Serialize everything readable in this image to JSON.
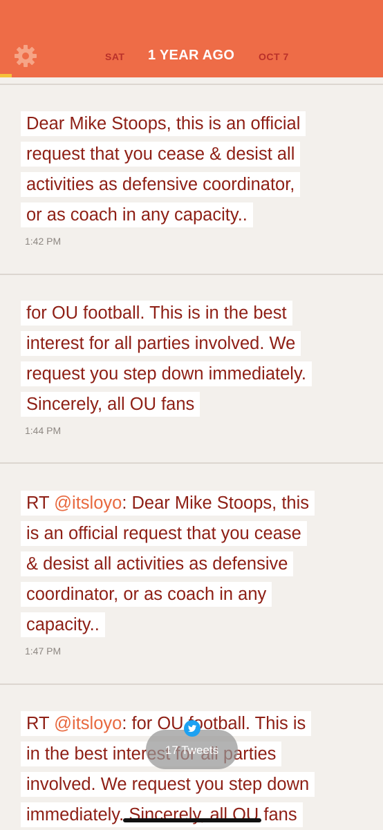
{
  "header": {
    "prev_day": "SAT",
    "current": "1 YEAR AGO",
    "next_day": "OCT 7",
    "progress_fraction": 0.03
  },
  "tweets": [
    {
      "lines": [
        "Dear Mike Stoops, this is an official",
        "request that you cease & desist all",
        "activities as defensive coordinator,",
        "or as coach in any capacity.."
      ],
      "time": "1:42 PM"
    },
    {
      "lines": [
        "for OU football. This is in the best",
        "interest for all parties involved. We",
        "request you step down immediately.",
        "Sincerely, all OU fans"
      ],
      "time": "1:44 PM"
    },
    {
      "rt_prefix": "RT ",
      "handle": "@itsloyo",
      "first_line_rest": ": Dear Mike Stoops, this",
      "lines": [
        "is an official request that you cease",
        "& desist all activities as defensive",
        "coordinator, or as coach in any",
        "capacity.."
      ],
      "time": "1:47 PM"
    },
    {
      "rt_prefix": "RT ",
      "handle": "@itsloyo",
      "first_line_rest": ": for OU football. This is",
      "lines": [
        "in the best interest for all parties",
        "involved. We request you step down",
        "immediately. Sincerely, all OU fans"
      ]
    }
  ],
  "pill": {
    "label": "17 Tweets",
    "icon": "twitter-bird-icon"
  },
  "colors": {
    "header_bg": "#ee6c47",
    "accent_text": "#8e1f15",
    "handle": "#e8693f",
    "page_bg": "#f3f0ec"
  }
}
